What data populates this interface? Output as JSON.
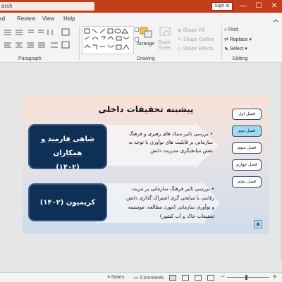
{
  "titlebar": {
    "search_placeholder": "arch",
    "signin": "Sign in",
    "controls": [
      "—",
      "☐",
      "✕"
    ]
  },
  "menu": {
    "tabs": [
      "rd",
      "Review",
      "View",
      "Help"
    ]
  },
  "ribbon": {
    "paragraph_label": "Paragraph",
    "drawing_label": "Drawing",
    "editing_label": "Editing",
    "arrange": "Arrange",
    "quick_styles": "Quick Styles",
    "shape_fill": "Shape Fill",
    "shape_outline": "Shape Outline",
    "shape_effects": "Shape Effects",
    "find": "Find",
    "replace": "Replace",
    "select": "Select"
  },
  "slide": {
    "title": "پیشینه تحقیقات داخلی",
    "box1_line1": "شاهی فارمند و همکاران",
    "box1_line2": "(۱۴۰۲)",
    "box2_line1": "کریمیون (۱۴۰۲)",
    "arrow1_lines": [
      "• بررسی تاثیر سبک های رهبری و فرهنگ",
      "سازمانی بر قابلیت های نوآوری با توجه به",
      "نقش میانجیگری مدیریت دانش"
    ],
    "arrow2_lines": [
      "• بررسی تاثیر فرهنگ سازمانی بر مزیت",
      "رقابتی با میانجی گری اشتراک گذاری دانش",
      "و نوآوری سازمانی (مورد مطالعه: موسسه",
      "تحقیقات خاک و آب کشور)"
    ],
    "nav_buttons": [
      "فصل اول",
      "فصل دوم",
      "فصل سوم",
      "فصل چهارم",
      "فصل پنجم"
    ],
    "active_nav": 1,
    "page_number": "۵"
  },
  "statusbar": {
    "notes": "Notes",
    "comments": "Comments"
  },
  "colors": {
    "titlebar": "#c43e1c",
    "navy": "#0e2f56",
    "active_nav": "#9edbf2"
  }
}
